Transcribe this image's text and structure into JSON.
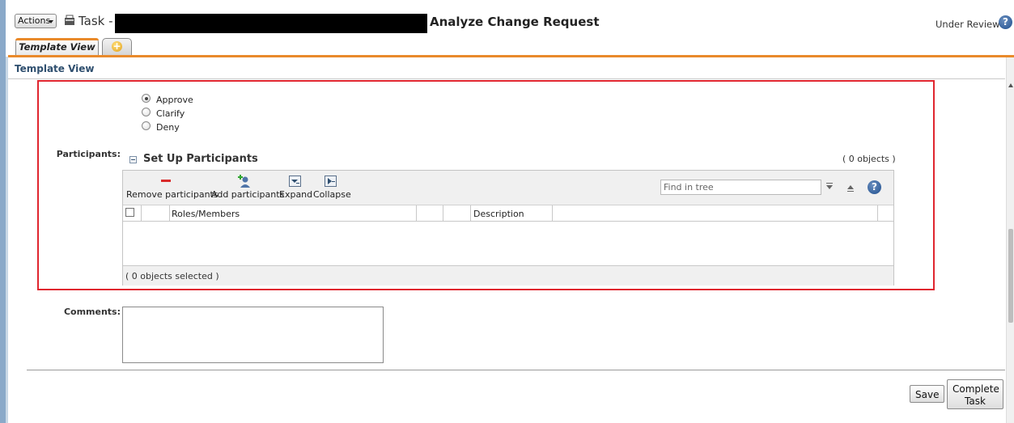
{
  "header": {
    "actions_label": "Actions",
    "task_prefix": "Task -",
    "task_name": "Analyze Change Request",
    "status": "Under Review",
    "help_glyph": "?"
  },
  "tabs": [
    {
      "label": "Template View",
      "active": true
    },
    {
      "label": "+",
      "icon": "add-tab-icon"
    }
  ],
  "section": {
    "title": "Template View"
  },
  "decision": {
    "options": [
      {
        "label": "Approve",
        "checked": true
      },
      {
        "label": "Clarify",
        "checked": false
      },
      {
        "label": "Deny",
        "checked": false
      }
    ]
  },
  "participants": {
    "label": "Participants:",
    "group_title": "Set Up Participants",
    "object_count": "( 0 objects )",
    "toolbar": {
      "remove": "Remove participants",
      "add": "Add participants",
      "expand": "Expand",
      "collapse": "Collapse"
    },
    "find_placeholder": "Find in tree",
    "columns": {
      "roles": "Roles/Members",
      "description": "Description"
    },
    "selected_text": "( 0 objects selected )"
  },
  "comments": {
    "label": "Comments:",
    "value": ""
  },
  "buttons": {
    "save": "Save",
    "complete_line1": "Complete",
    "complete_line2": "Task"
  },
  "colors": {
    "accent": "#e98a2b",
    "highlight": "#e0262f",
    "title": "#2f4f6f"
  }
}
